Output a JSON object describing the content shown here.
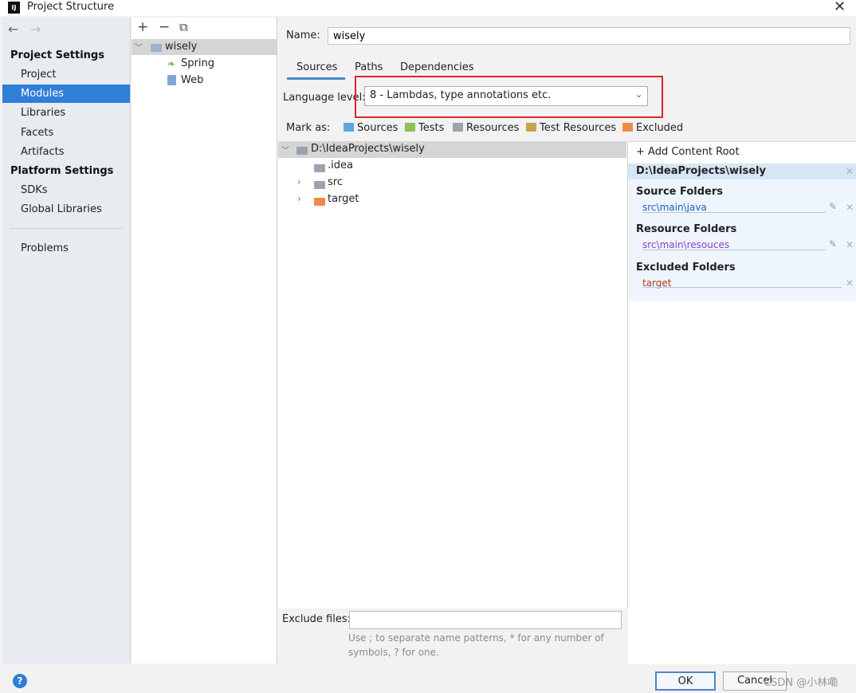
{
  "window": {
    "title": "Project Structure",
    "app_icon_text": "IJ",
    "close_glyph": "✕"
  },
  "nav": {
    "back": "←",
    "forward": "→",
    "project_settings_header": "Project Settings",
    "project_settings_items": [
      "Project",
      "Modules",
      "Libraries",
      "Facets",
      "Artifacts"
    ],
    "platform_settings_header": "Platform Settings",
    "platform_settings_items": [
      "SDKs",
      "Global Libraries"
    ],
    "problems": "Problems",
    "selected": "Modules"
  },
  "modules": {
    "toolbar": {
      "add": "+",
      "remove": "−",
      "copy": "⧉"
    },
    "tree": {
      "root": "wisely",
      "children": [
        "Spring",
        "Web"
      ]
    }
  },
  "main": {
    "name_label": "Name:",
    "name_value": "wisely",
    "tabs": [
      "Sources",
      "Paths",
      "Dependencies"
    ],
    "active_tab": "Sources",
    "language_level_label": "Language level:",
    "language_level_value": "8 - Lambdas, type annotations etc.",
    "mark_as_label": "Mark as:",
    "mark_as": [
      {
        "label": "Sources",
        "color": "#5aa7e0"
      },
      {
        "label": "Tests",
        "color": "#8fbf56"
      },
      {
        "label": "Resources",
        "color": "#9aa3ae"
      },
      {
        "label": "Test Resources",
        "color": "#c9a34c"
      },
      {
        "label": "Excluded",
        "color": "#f08a4b"
      }
    ]
  },
  "content_tree": {
    "root": "D:\\IdeaProjects\\wisely",
    "items": [
      ".idea",
      "src",
      "target"
    ]
  },
  "content_roots": {
    "add_label": "+ Add Content Root",
    "root_path": "D:\\IdeaProjects\\wisely",
    "source_header": "Source Folders",
    "source_path": "src\\main\\java",
    "resource_header": "Resource Folders",
    "resource_path": "src\\main\\resouces",
    "excluded_header": "Excluded Folders",
    "excluded_path": "target",
    "colors": {
      "source": "#1f5fbf",
      "resource": "#8b3fc6",
      "excluded": "#b23a1a"
    }
  },
  "exclude_files": {
    "label": "Exclude files:",
    "value": "",
    "hint": "Use ; to separate name patterns, * for any number of symbols, ? for one."
  },
  "footer": {
    "help": "?",
    "ok": "OK",
    "cancel": "Cancel",
    "watermark": "CSDN @小林嘞"
  }
}
